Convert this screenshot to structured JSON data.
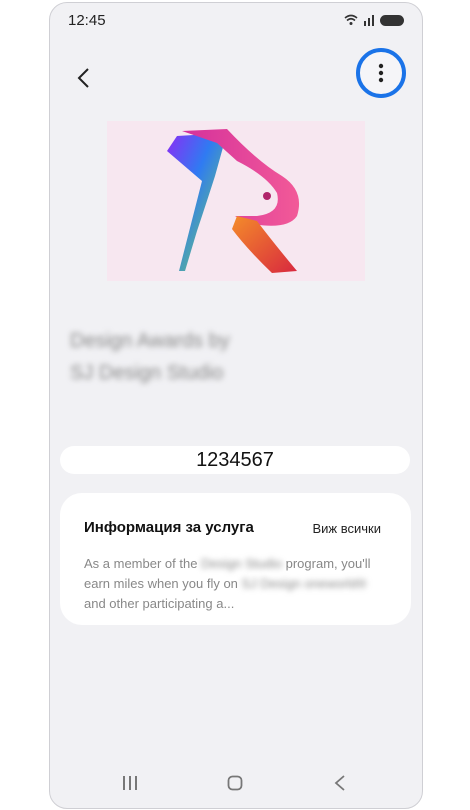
{
  "status_bar": {
    "time": "12:45"
  },
  "toolbar": {
    "back_icon": "chevron-left-icon",
    "more_icon": "vertical-dots-icon",
    "accent": "#1a73e8"
  },
  "card": {
    "logo_icon": "rabbit-r-logo",
    "name_line1": "Design Awards by",
    "name_line2": "SJ Design Studio",
    "number": "1234567"
  },
  "service_info": {
    "title": "Информация за услуга",
    "view_all": "Виж всички",
    "desc_part1": "As a member of the ",
    "desc_blur1": "Design Studio",
    "desc_part2": " program, you'll earn miles when you fly on ",
    "desc_blur2": "SJ Design oneworld®",
    "desc_part3": " and other participating a..."
  },
  "nav_bar": {
    "recents_icon": "recents-icon",
    "home_icon": "home-icon",
    "back_icon": "back-icon"
  }
}
